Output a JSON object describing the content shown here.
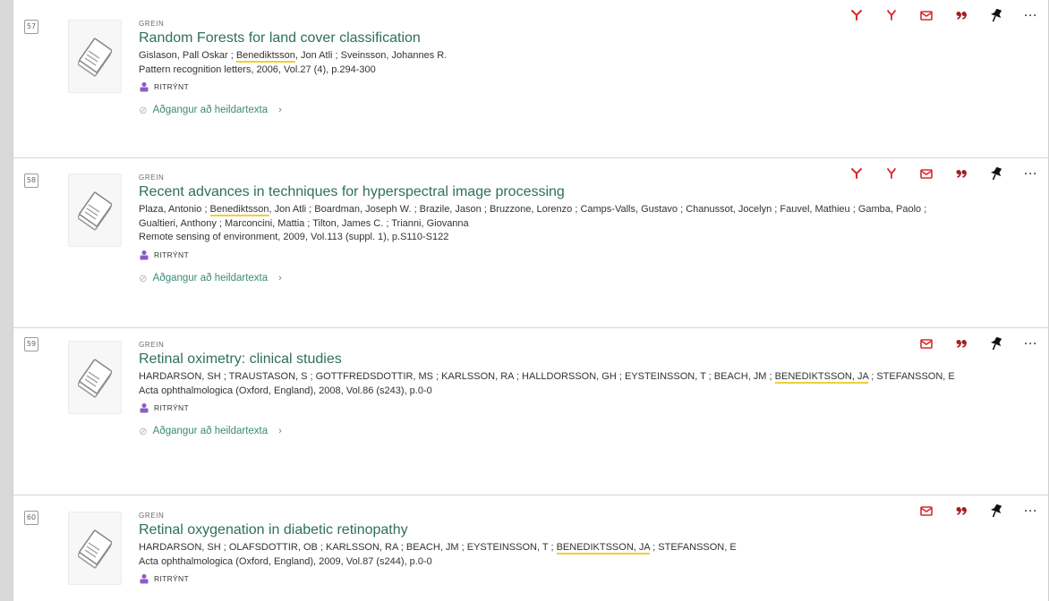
{
  "labels": {
    "peer_reviewed": "RITRÝNT",
    "more": "···"
  },
  "colors": {
    "accent": "#d8282c",
    "title": "#2e6f5f",
    "link": "#3b8a78",
    "highlight": "#f0cf38",
    "badge": "#8b5cc8"
  },
  "records": [
    {
      "number": "57",
      "type": "GREIN",
      "title": "Random Forests for land cover classification",
      "authors_pre": "Gislason, Pall Oskar ; ",
      "authors_hl": "Benediktsson",
      "authors_post": ", Jon Atli ; Sveinsson, Johannes R.",
      "source": "Pattern recognition letters, 2006, Vol.27 (4), p.294-300",
      "access": "Aðgangur að heildartexta"
    },
    {
      "number": "58",
      "type": "GREIN",
      "title": "Recent advances in techniques for hyperspectral image processing",
      "authors_pre": "Plaza, Antonio ; ",
      "authors_hl": "Benediktsson",
      "authors_post": ", Jon Atli ; Boardman, Joseph W. ; Brazile, Jason ; Bruzzone, Lorenzo ; Camps-Valls, Gustavo ; Chanussot, Jocelyn ; Fauvel, Mathieu ; Gamba, Paolo ; Gualtieri, Anthony ; Marconcini, Mattia ; Tilton, James C. ; Trianni, Giovanna",
      "source": "Remote sensing of environment, 2009, Vol.113 (suppl. 1), p.S110-S122",
      "access": "Aðgangur að heildartexta"
    },
    {
      "number": "59",
      "type": "GREIN",
      "title": "Retinal oximetry: clinical studies",
      "authors_pre": "HARDARSON, SH ; TRAUSTASON, S ; GOTTFREDSDOTTIR, MS ; KARLSSON, RA ; HALLDORSSON, GH ; EYSTEINSSON, T ; BEACH, JM ; ",
      "authors_hl": "BENEDIKTSSON, JA",
      "authors_post": " ; STEFANSSON, E",
      "source": "Acta ophthalmologica (Oxford, England), 2008, Vol.86 (s243), p.0-0",
      "access": "Aðgangur að heildartexta"
    },
    {
      "number": "60",
      "type": "GREIN",
      "title": "Retinal oxygenation in diabetic retinopathy",
      "authors_pre": "HARDARSON, SH ; OLAFSDOTTIR, OB ; KARLSSON, RA ; BEACH, JM ; EYSTEINSSON, T ; ",
      "authors_hl": "BENEDIKTSSON, JA",
      "authors_post": " ; STEFANSSON, E",
      "source": "Acta ophthalmologica (Oxford, England), 2009, Vol.87 (s244), p.0-0",
      "access": ""
    }
  ]
}
